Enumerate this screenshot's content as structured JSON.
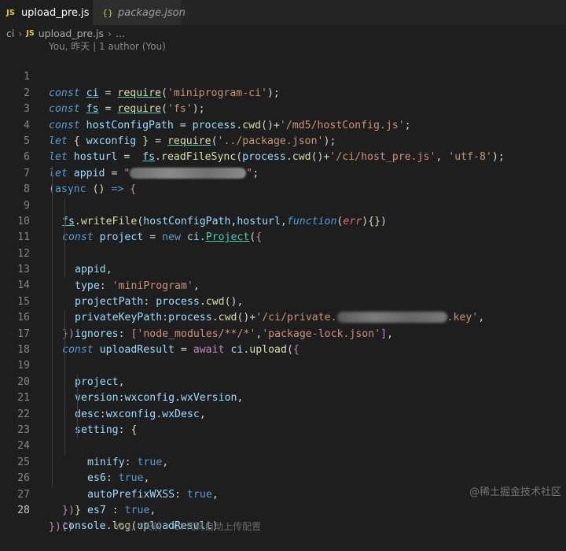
{
  "tabs": [
    {
      "icon": "JS",
      "label": "upload_pre.js",
      "active": true
    },
    {
      "icon": "{}",
      "label": "package.json",
      "active": false
    }
  ],
  "breadcrumb": {
    "folder": "ci",
    "file_icon": "JS",
    "file": "upload_pre.js",
    "more": "..."
  },
  "codelens": "You, 昨天 | 1 author (You)",
  "line_numbers": [
    "1",
    "2",
    "3",
    "4",
    "5",
    "6",
    "7",
    "8",
    "9",
    "10",
    "11",
    "12",
    "13",
    "14",
    "15",
    "16",
    "17",
    "18",
    "19",
    "20",
    "21",
    "22",
    "23",
    "24",
    "25",
    "26",
    "27",
    "28"
  ],
  "code": {
    "l1": {
      "kw": "const",
      "name": "ci",
      "eq": "=",
      "fn": "require",
      "str": "'miniprogram-ci'",
      "end": ");"
    },
    "l2": {
      "kw": "const",
      "name": "fs",
      "eq": "=",
      "fn": "require",
      "str": "'fs'",
      "end": ");"
    },
    "l3": {
      "kw": "const",
      "name": "hostConfigPath",
      "eq": "=",
      "obj": "process",
      "fn": "cwd",
      "str": "'/md5/hostConfig.js'",
      "end": ";"
    },
    "l4": {
      "kw": "let",
      "lb": "{",
      "name": "wxconfig",
      "rb": "}",
      "eq": "=",
      "fn": "require",
      "str": "'../package.json'",
      "end": ");"
    },
    "l5": {
      "kw": "let",
      "name": "hosturl",
      "eq": "=",
      "obj": "fs",
      "fn": "readFileSync",
      "arg": "process",
      "fn2": "cwd",
      "str": "'/ci/host_pre.js'",
      "str2": "'utf-8'",
      "end": ");"
    },
    "l6": {
      "kw": "let",
      "name": "appid",
      "eq": "=",
      "str_open": "\"",
      "str_close": "\"",
      "end": ";"
    },
    "l7": {
      "kw": "async",
      "arrow": "=>"
    },
    "l8": {
      "obj": "fs",
      "fn": "writeFile",
      "args": "hostConfigPath,hosturl,",
      "kw": "function",
      "param": "err"
    },
    "l9": {
      "kw": "const",
      "name": "project",
      "eq": "=",
      "new": "new",
      "obj": "ci",
      "cls": "Project"
    },
    "l10": {
      "prop": "appid"
    },
    "l11": {
      "prop": "type",
      "str": "'miniProgram'"
    },
    "l12": {
      "prop": "projectPath",
      "obj": "process",
      "fn": "cwd"
    },
    "l13": {
      "prop": "privateKeyPath",
      "obj": "process",
      "fn": "cwd",
      "str": "'/ci/private.",
      "str_end": ".key'"
    },
    "l14": {
      "prop": "ignores",
      "s1": "'node_modules/**/*'",
      "s2": "'package-lock.json'"
    },
    "l15": {
      "close": "})"
    },
    "l16": {
      "kw": "const",
      "name": "uploadResult",
      "eq": "=",
      "await": "await",
      "obj": "ci",
      "fn": "upload"
    },
    "l17": {
      "prop": "project"
    },
    "l18": {
      "prop": "version",
      "val": "wxconfig.wxVersion"
    },
    "l19": {
      "prop": "desc",
      "val": "wxconfig.wxDesc"
    },
    "l20": {
      "prop": "setting"
    },
    "l21": {
      "prop": "minify",
      "val": "true"
    },
    "l22": {
      "prop": "es6",
      "val": "true"
    },
    "l23": {
      "prop": "autoPrefixWXSS",
      "val": "true"
    },
    "l24": {
      "prop": "es7",
      "val": "true"
    },
    "l25": {
      "close": "}"
    },
    "l26": {
      "close": "})"
    },
    "l27": {
      "obj": "console",
      "fn": "log",
      "arg": "uploadResult"
    },
    "l28": {
      "text": "})()"
    }
  },
  "blame": "You, 4天前 • CI 代码自动上传配置",
  "watermark": "@稀土掘金技术社区"
}
